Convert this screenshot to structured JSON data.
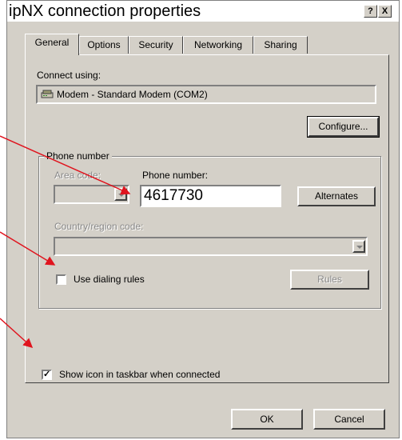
{
  "window": {
    "title": "ipNX connection properties",
    "help_glyph": "?",
    "close_glyph": "X"
  },
  "tabs": [
    {
      "label": "General",
      "active": true
    },
    {
      "label": "Options",
      "active": false
    },
    {
      "label": "Security",
      "active": false
    },
    {
      "label": "Networking",
      "active": false
    },
    {
      "label": "Sharing",
      "active": false
    }
  ],
  "connect": {
    "label": "Connect using:",
    "device": "Modem - Standard Modem (COM2)",
    "configure_label": "Configure..."
  },
  "phone": {
    "group_label": "Phone number",
    "area_code_label": "Area code:",
    "area_code_value": "",
    "phone_label": "Phone number:",
    "phone_value": "4617730",
    "alternates_label": "Alternates",
    "country_label": "Country/region code:",
    "country_value": "",
    "use_dialing_rules_label": "Use dialing rules",
    "use_dialing_rules_checked": false,
    "rules_label": "Rules"
  },
  "show_icon": {
    "label": "Show icon in taskbar when connected",
    "checked": true
  },
  "footer": {
    "ok_label": "OK",
    "cancel_label": "Cancel"
  },
  "colors": {
    "dialog_bg": "#d4d0c8",
    "annotation_arrow": "#e0141e"
  }
}
